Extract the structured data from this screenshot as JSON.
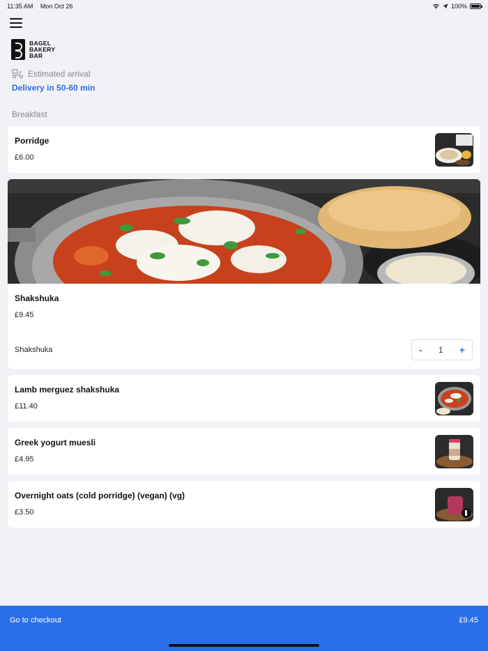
{
  "status": {
    "time": "11:35 AM",
    "date": "Mon Oct 26",
    "battery": "100%"
  },
  "brand": {
    "line1": "BAGEL",
    "line2": "BAKERY",
    "line3": "BAR"
  },
  "delivery": {
    "estimated_label": "Estimated arrival",
    "window": "Delivery in 50-60 min"
  },
  "section": {
    "title": "Breakfast"
  },
  "items": [
    {
      "name": "Porridge",
      "price": "£6.00"
    },
    {
      "name": "Shakshuka",
      "price": "£9.45",
      "variant_label": "Shakshuka",
      "quantity": "1"
    },
    {
      "name": "Lamb merguez shakshuka",
      "price": "£11.40"
    },
    {
      "name": "Greek yogurt muesli",
      "price": "£4.95"
    },
    {
      "name": "Overnight oats (cold porridge) (vegan) (vg)",
      "price": "£3.50"
    }
  ],
  "stepper": {
    "minus": "-",
    "plus": "+"
  },
  "checkout": {
    "label": "Go to checkout",
    "total": "£9.45"
  },
  "colors": {
    "accent": "#2b6fe8",
    "link": "#2f6ee0",
    "background": "#f1f1f6"
  }
}
